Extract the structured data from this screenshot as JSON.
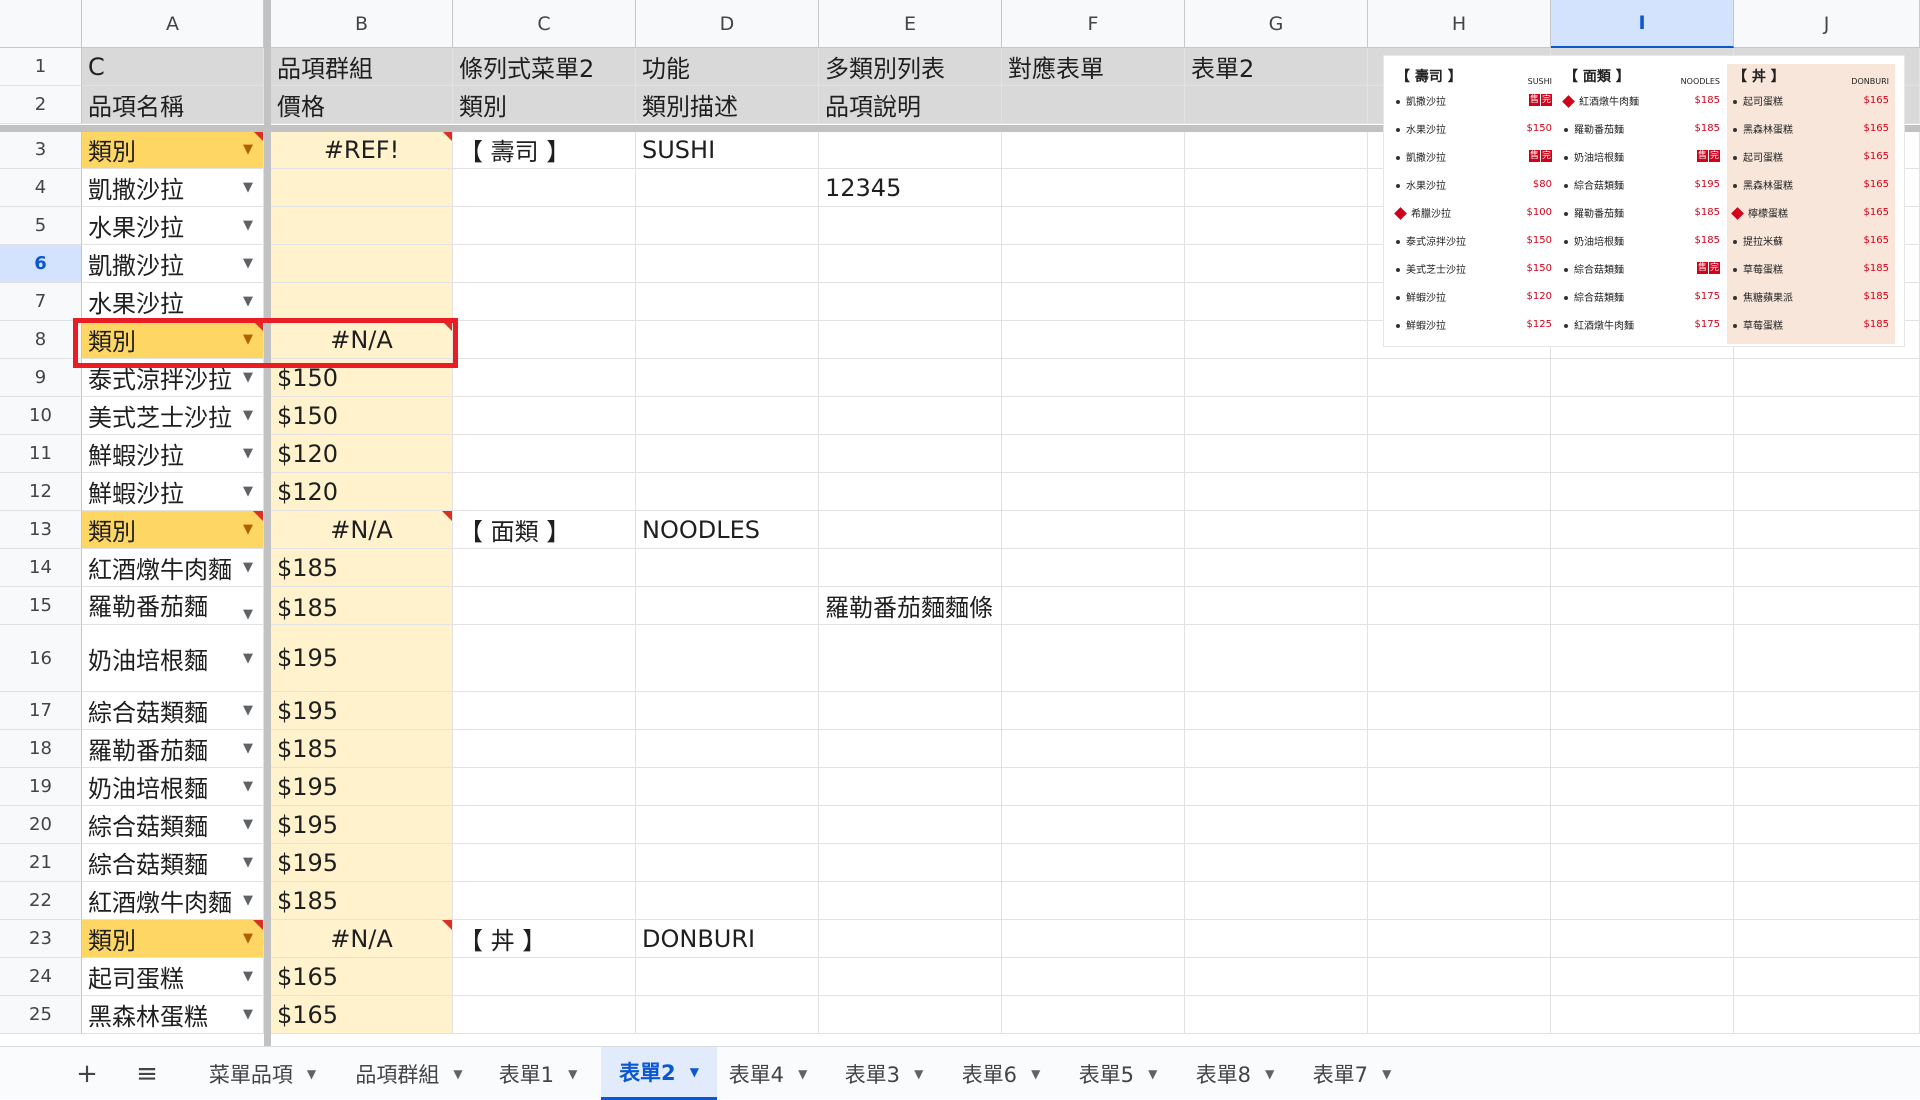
{
  "columns": [
    "A",
    "B",
    "C",
    "D",
    "E",
    "F",
    "G",
    "H",
    "I",
    "J"
  ],
  "selected_column": "I",
  "selected_row": "6",
  "rows": [
    {
      "n": "1",
      "a": "C",
      "b": "品項群組",
      "c": "條列式菜單2",
      "d": "功能",
      "e": "多類別列表",
      "f": "對應表單",
      "g": "表單2"
    },
    {
      "n": "2",
      "a": "品項名稱",
      "b": "價格",
      "c": "類別",
      "d": "類別描述",
      "e": "品項說明",
      "f": "",
      "g": ""
    },
    {
      "n": "3",
      "a": "類別",
      "b": "#REF!",
      "c": "【 壽司 】",
      "d": "SUSHI",
      "e": ""
    },
    {
      "n": "4",
      "a": "凱撒沙拉",
      "b": "",
      "c": "",
      "d": "",
      "e": "12345"
    },
    {
      "n": "5",
      "a": "水果沙拉",
      "b": "",
      "c": "",
      "d": "",
      "e": ""
    },
    {
      "n": "6",
      "a": "凱撒沙拉",
      "b": "",
      "c": "",
      "d": "",
      "e": ""
    },
    {
      "n": "7",
      "a": "水果沙拉",
      "b": "",
      "c": "",
      "d": "",
      "e": ""
    },
    {
      "n": "8",
      "a": "類別",
      "b": "#N/A",
      "c": "",
      "d": "",
      "e": ""
    },
    {
      "n": "9",
      "a": "泰式涼拌沙拉",
      "b": "$150",
      "c": "",
      "d": "",
      "e": ""
    },
    {
      "n": "10",
      "a": "美式芝士沙拉",
      "b": "$150",
      "c": "",
      "d": "",
      "e": ""
    },
    {
      "n": "11",
      "a": "鮮蝦沙拉",
      "b": "$120",
      "c": "",
      "d": "",
      "e": ""
    },
    {
      "n": "12",
      "a": "鮮蝦沙拉",
      "b": "$120",
      "c": "",
      "d": "",
      "e": ""
    },
    {
      "n": "13",
      "a": "類別",
      "b": "#N/A",
      "c": "【 面類 】",
      "d": "NOODLES",
      "e": ""
    },
    {
      "n": "14",
      "a": "紅酒燉牛肉麵",
      "b": "$185",
      "c": "",
      "d": "",
      "e": ""
    },
    {
      "n": "15",
      "a": "羅勒番茄麵",
      "b": "$185",
      "c": "",
      "d": "",
      "e": "羅勒番茄麵麵條好吃"
    },
    {
      "n": "16",
      "a": "奶油培根麵",
      "b": "$195",
      "c": "",
      "d": "",
      "e": ""
    },
    {
      "n": "17",
      "a": "綜合菇類麵",
      "b": "$195",
      "c": "",
      "d": "",
      "e": ""
    },
    {
      "n": "18",
      "a": "羅勒番茄麵",
      "b": "$185",
      "c": "",
      "d": "",
      "e": ""
    },
    {
      "n": "19",
      "a": "奶油培根麵",
      "b": "$195",
      "c": "",
      "d": "",
      "e": ""
    },
    {
      "n": "20",
      "a": "綜合菇類麵",
      "b": "$195",
      "c": "",
      "d": "",
      "e": ""
    },
    {
      "n": "21",
      "a": "綜合菇類麵",
      "b": "$195",
      "c": "",
      "d": "",
      "e": ""
    },
    {
      "n": "22",
      "a": "紅酒燉牛肉麵",
      "b": "$185",
      "c": "",
      "d": "",
      "e": ""
    },
    {
      "n": "23",
      "a": "類別",
      "b": "#N/A",
      "c": "【 丼 】",
      "d": "DONBURI",
      "e": ""
    },
    {
      "n": "24",
      "a": "起司蛋糕",
      "b": "$165",
      "c": "",
      "d": "",
      "e": ""
    },
    {
      "n": "25",
      "a": "黑森林蛋糕",
      "b": "$165",
      "c": "",
      "d": "",
      "e": ""
    }
  ],
  "menu_image": {
    "columns": [
      {
        "title": "【 壽司 】",
        "subtitle": "SUSHI",
        "items": [
          {
            "name": "凱撒沙拉",
            "price": "",
            "sold": [
              "售",
              "完"
            ],
            "mark": ""
          },
          {
            "name": "水果沙拉",
            "price": "$150",
            "sold": [],
            "mark": ""
          },
          {
            "name": "凱撒沙拉",
            "price": "",
            "sold": [
              "售",
              "完"
            ],
            "mark": ""
          },
          {
            "name": "水果沙拉",
            "price": "$80",
            "sold": [],
            "mark": ""
          },
          {
            "name": "希臘沙拉",
            "price": "$100",
            "sold": [],
            "mark": "diamond"
          },
          {
            "name": "泰式涼拌沙拉",
            "price": "$150",
            "sold": [],
            "mark": ""
          },
          {
            "name": "美式芝士沙拉",
            "price": "$150",
            "sold": [],
            "mark": ""
          },
          {
            "name": "鮮蝦沙拉",
            "price": "$120",
            "sold": [],
            "mark": ""
          },
          {
            "name": "鮮蝦沙拉",
            "price": "$125",
            "sold": [],
            "mark": ""
          }
        ]
      },
      {
        "title": "【 面類 】",
        "subtitle": "NOODLES",
        "items": [
          {
            "name": "紅酒燉牛肉麵",
            "price": "$185",
            "sold": [],
            "mark": "diamond"
          },
          {
            "name": "羅勒番茄麵",
            "price": "$185",
            "sold": [],
            "mark": ""
          },
          {
            "name": "奶油培根麵",
            "price": "",
            "sold": [
              "售",
              "完"
            ],
            "mark": ""
          },
          {
            "name": "綜合菇類麵",
            "price": "$195",
            "sold": [],
            "mark": ""
          },
          {
            "name": "羅勒番茄麵",
            "price": "$185",
            "sold": [],
            "mark": ""
          },
          {
            "name": "奶油培根麵",
            "price": "$185",
            "sold": [],
            "mark": ""
          },
          {
            "name": "綜合菇類麵",
            "price": "",
            "sold": [
              "售",
              "完"
            ],
            "mark": ""
          },
          {
            "name": "綜合菇類麵",
            "price": "$175",
            "sold": [],
            "mark": ""
          },
          {
            "name": "紅酒燉牛肉麵",
            "price": "$175",
            "sold": [],
            "mark": ""
          }
        ]
      },
      {
        "title": "【 丼 】",
        "subtitle": "DONBURI",
        "items": [
          {
            "name": "起司蛋糕",
            "price": "$165",
            "sold": [],
            "mark": ""
          },
          {
            "name": "黑森林蛋糕",
            "price": "$165",
            "sold": [],
            "mark": ""
          },
          {
            "name": "起司蛋糕",
            "price": "$165",
            "sold": [],
            "mark": ""
          },
          {
            "name": "黑森林蛋糕",
            "price": "$165",
            "sold": [],
            "mark": ""
          },
          {
            "name": "檸檬蛋糕",
            "price": "$165",
            "sold": [],
            "mark": "diamond"
          },
          {
            "name": "提拉米蘇",
            "price": "$165",
            "sold": [],
            "mark": ""
          },
          {
            "name": "草莓蛋糕",
            "price": "$185",
            "sold": [],
            "mark": ""
          },
          {
            "name": "焦糖蘋果派",
            "price": "$185",
            "sold": [],
            "mark": ""
          },
          {
            "name": "草莓蛋糕",
            "price": "$185",
            "sold": [],
            "mark": ""
          }
        ]
      }
    ]
  },
  "tabbar": {
    "add_icon": "+",
    "list_icon": "≡",
    "tabs": [
      "菜單品項",
      "品項群組",
      "表單1",
      "表單2",
      "表單4",
      "表單3",
      "表單6",
      "表單5",
      "表單8",
      "表單7"
    ],
    "active": "表單2"
  },
  "colors": {
    "category_fill": "#fdd663",
    "band_fill": "#fff2cc",
    "header_band": "#d9d9d9",
    "selection": "#ea1c24",
    "accent": "#0b57d0"
  }
}
